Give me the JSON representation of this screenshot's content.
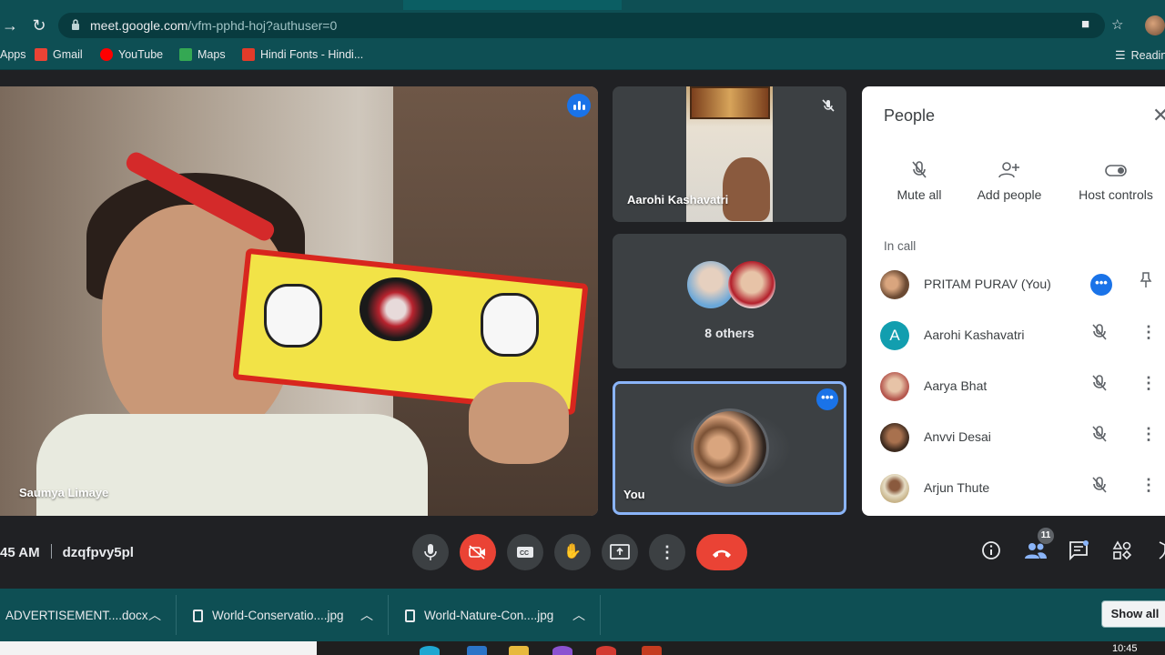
{
  "browser": {
    "url_host": "meet.google.com",
    "url_path": "/vfm-pphd-hoj?authuser=0",
    "bookmarks": [
      {
        "label": "Apps",
        "color": "#4285f4"
      },
      {
        "label": "Gmail",
        "color": "#ea4335"
      },
      {
        "label": "YouTube",
        "color": "#ff0000"
      },
      {
        "label": "Maps",
        "color": "#34a853"
      },
      {
        "label": "Hindi Fonts - Hindi...",
        "color": "#e23b2a"
      }
    ],
    "reading_list": "Readin"
  },
  "main_tile": {
    "name": "Saumya Limaye"
  },
  "tiles": {
    "tile1_name": "Aarohi Kashavatri",
    "tile2_label": "8 others",
    "tile3_name": "You"
  },
  "panel": {
    "title": "People",
    "actions": [
      {
        "label": "Mute all",
        "icon": "mic-off-icon"
      },
      {
        "label": "Add people",
        "icon": "person-add-icon"
      },
      {
        "label": "Host controls",
        "icon": "toggle-icon"
      }
    ],
    "section": "In call",
    "people": [
      {
        "name": "PRITAM PURAV (You)",
        "avatar_color": "#8d5b3a"
      },
      {
        "name": "Aarohi Kashavatri",
        "avatar_letter": "A",
        "avatar_color": "#129eaf"
      },
      {
        "name": "Aarya Bhat",
        "avatar_color": "#b5574e"
      },
      {
        "name": "Anvvi Desai",
        "avatar_color": "#5a3b2a"
      },
      {
        "name": "Arjun Thute",
        "avatar_color": "#c8b48a"
      }
    ]
  },
  "controls": {
    "time": "45 AM",
    "meeting_code": "dzqfpvy5pl",
    "people_count": "11"
  },
  "downloads": {
    "files": [
      {
        "name": "ADVERTISEMENT....docx"
      },
      {
        "name": "World-Conservatio....jpg"
      },
      {
        "name": "World-Nature-Con....jpg"
      }
    ],
    "show_all": "Show all"
  },
  "taskbar": {
    "clock": "10:45"
  }
}
